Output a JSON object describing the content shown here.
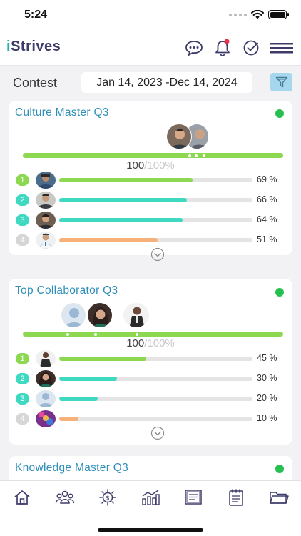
{
  "status": {
    "time": "5:24"
  },
  "app": {
    "logo_i": "i",
    "logo_rest": "Strives"
  },
  "filter": {
    "label": "Contest",
    "date_range": "Jan 14, 2023 -Dec 14, 2024"
  },
  "icons": {
    "chat": "chat-icon",
    "bell": "bell-icon",
    "check": "check-circle-icon",
    "menu": "hamburger-menu-icon",
    "filter": "filter-icon",
    "expand": "chevron-down-icon"
  },
  "colors": {
    "title": "#2f8fb8",
    "active": "#25c04f",
    "rank1": "#8cd850",
    "rank2": "#3fd8c0",
    "rank3": "#3fd8c0",
    "rank4": "#f6b079",
    "badge4": "#d6d6d6"
  },
  "cards": [
    {
      "title": "Culture Master Q3",
      "score": "100",
      "total": "/100%",
      "ranks": [
        {
          "rank": "1",
          "pct": "69 %",
          "progress": 0.69
        },
        {
          "rank": "2",
          "pct": "66 %",
          "progress": 0.66
        },
        {
          "rank": "3",
          "pct": "64 %",
          "progress": 0.64
        },
        {
          "rank": "4",
          "pct": "51 %",
          "progress": 0.51
        }
      ]
    },
    {
      "title": "Top Collaborator Q3",
      "score": "100",
      "total": "/100%",
      "ranks": [
        {
          "rank": "1",
          "pct": "45 %",
          "progress": 0.45
        },
        {
          "rank": "2",
          "pct": "30 %",
          "progress": 0.3
        },
        {
          "rank": "3",
          "pct": "20 %",
          "progress": 0.2
        },
        {
          "rank": "4",
          "pct": "10 %",
          "progress": 0.1
        }
      ]
    },
    {
      "title": "Knowledge Master Q3"
    }
  ],
  "tabs": [
    "home-icon",
    "team-icon",
    "rewards-icon",
    "analytics-icon",
    "board-icon",
    "tasks-icon",
    "folder-icon"
  ]
}
